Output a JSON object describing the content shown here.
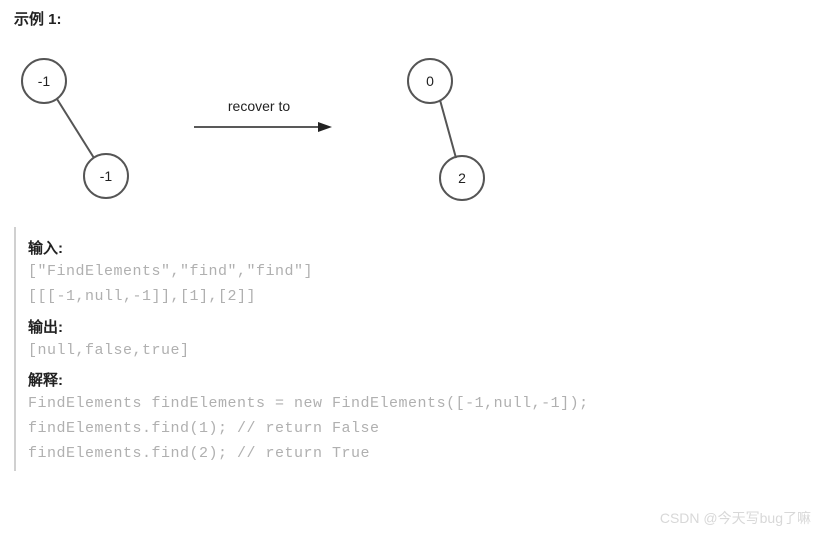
{
  "heading": "示例 1:",
  "diagram": {
    "left_root": "-1",
    "left_child": "-1",
    "arrow_label": "recover to",
    "right_root": "0",
    "right_child": "2"
  },
  "example": {
    "input_label": "输入:",
    "input_line1": "[\"FindElements\",\"find\",\"find\"]",
    "input_line2": "[[[-1,null,-1]],[1],[2]]",
    "output_label": "输出:",
    "output_line1": "[null,false,true]",
    "explain_label": "解释:",
    "explain_line1": "FindElements findElements = new FindElements([-1,null,-1]);",
    "explain_line2": "findElements.find(1); // return False",
    "explain_line3": "findElements.find(2); // return True"
  },
  "watermark": "CSDN @今天写bug了嘛"
}
